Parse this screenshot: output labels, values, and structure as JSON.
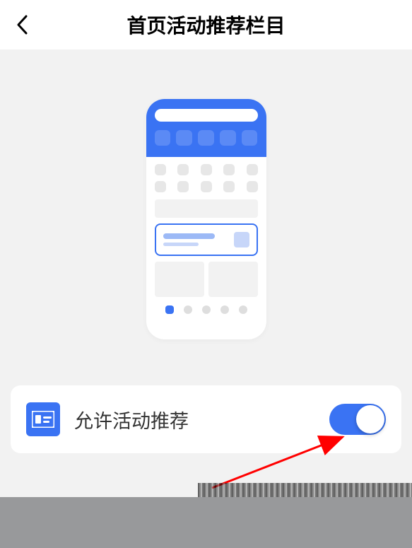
{
  "header": {
    "title": "首页活动推荐栏目"
  },
  "setting": {
    "label": "允许活动推荐",
    "toggle": true
  }
}
